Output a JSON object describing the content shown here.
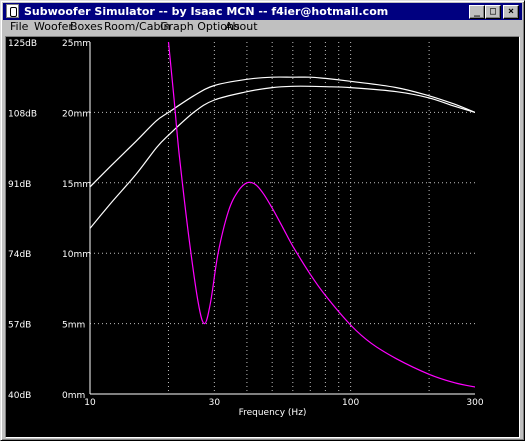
{
  "window": {
    "title": "Subwoofer Simulator -- by Isaac MCN -- f4ier@hotmail.com",
    "controls": [
      "_",
      "□",
      "×"
    ]
  },
  "menu": [
    "File",
    "Woofer",
    "Boxes",
    "Room/Cabin",
    "Graph Options",
    "About"
  ],
  "chart_data": {
    "type": "line",
    "xlabel": "Frequency (Hz)",
    "x_scale": "log",
    "xlim": [
      10,
      300
    ],
    "x_tick_labels": [
      "10",
      "30",
      "100",
      "300"
    ],
    "x_ticks": [
      10,
      30,
      100,
      300
    ],
    "x_gridlines": [
      20,
      30,
      40,
      50,
      60,
      70,
      80,
      90,
      100,
      200
    ],
    "y_left_tick_labels": [
      "125dB",
      "108dB",
      "91dB",
      "74dB",
      "57dB",
      "40dB"
    ],
    "y_right_tick_labels": [
      "25mm",
      "20mm",
      "15mm",
      "10mm",
      "5mm",
      "0mm"
    ],
    "ylim_db": [
      40,
      125
    ],
    "ylim_mm": [
      0,
      25
    ],
    "grid": true,
    "colors": {
      "spl": "#ffffff",
      "excursion": "#ff00ff",
      "grid": "#bfbfbf",
      "axis": "#ffffff"
    },
    "series": [
      {
        "unit": "dB",
        "x": [
          10,
          12,
          15,
          18,
          20,
          25,
          30,
          40,
          50,
          60,
          70,
          80,
          100,
          150,
          200,
          250,
          300
        ],
        "values": [
          90,
          95,
          101,
          106,
          108,
          112,
          114.5,
          116,
          116.5,
          116.5,
          116.5,
          116.2,
          115.5,
          114,
          112,
          110,
          108
        ]
      },
      {
        "unit": "dB",
        "x": [
          10,
          12,
          15,
          18,
          20,
          25,
          30,
          40,
          50,
          60,
          70,
          80,
          100,
          150,
          200,
          250,
          300
        ],
        "values": [
          80,
          86,
          93,
          99.5,
          102.5,
          108,
          111,
          113,
          114,
          114.3,
          114.3,
          114.2,
          114,
          113,
          111.5,
          109.5,
          108
        ]
      },
      {
        "unit": "mm",
        "x": [
          20,
          21,
          22,
          24,
          26,
          27.5,
          29,
          31,
          34,
          37,
          40,
          43,
          46,
          50,
          55,
          60,
          70,
          80,
          100,
          120,
          150,
          200,
          250,
          300
        ],
        "values": [
          25,
          21,
          17,
          11,
          6.5,
          5,
          6.5,
          10,
          13,
          14.4,
          15,
          14.9,
          14.3,
          13.2,
          11.8,
          10.5,
          8.5,
          7,
          4.9,
          3.6,
          2.5,
          1.4,
          0.8,
          0.5
        ]
      }
    ]
  }
}
